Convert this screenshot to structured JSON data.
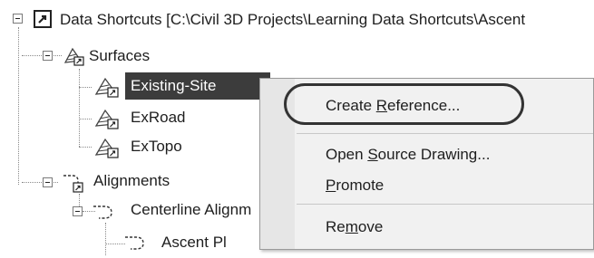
{
  "tree": {
    "root": {
      "label": "Data Shortcuts [C:\\Civil 3D Projects\\Learning Data Shortcuts\\Ascent"
    },
    "surfaces": {
      "label": "Surfaces",
      "items": [
        {
          "label": "Existing-Site",
          "selected": true
        },
        {
          "label": "ExRoad"
        },
        {
          "label": "ExTopo"
        }
      ]
    },
    "alignments": {
      "label": "Alignments",
      "centerline": {
        "label": "Centerline Alignm",
        "items": [
          {
            "label": "Ascent Pl"
          }
        ]
      }
    }
  },
  "context_menu": {
    "items": [
      {
        "pre": "Create ",
        "accel": "R",
        "post": "eference...",
        "highlighted": true
      },
      {
        "pre": "Open ",
        "accel": "S",
        "post": "ource Drawing..."
      },
      {
        "pre": "",
        "accel": "P",
        "post": "romote"
      },
      {
        "pre": "Re",
        "accel": "m",
        "post": "ove"
      }
    ]
  },
  "icons": {
    "root": "data-shortcuts-root-icon",
    "surface": "surface-shortcut-icon",
    "alignment": "alignment-shortcut-icon"
  },
  "colors": {
    "selection": "#3c3c3c",
    "menu_bg": "#f1f1f1",
    "highlight_ring": "#333333"
  }
}
